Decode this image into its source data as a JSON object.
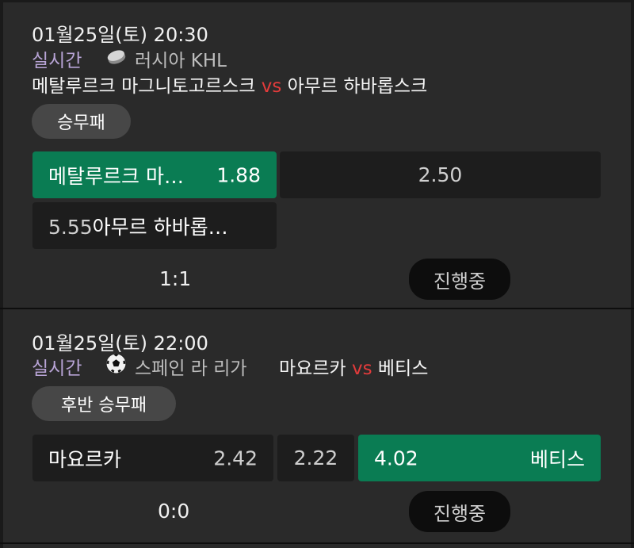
{
  "matches": [
    {
      "datetime": "01월25일(토) 20:30",
      "live_label": "실시간",
      "sport_icon": "hockey-puck-icon",
      "league": "러시아 KHL",
      "home": "메탈루르크 마그니토고르스크",
      "vs": "vs",
      "away": "아무르 하바롭스크",
      "market": "승무패",
      "odds": [
        {
          "name": "메탈루르크 마…",
          "value": "1.88",
          "selected": true
        },
        {
          "name": "",
          "value": "2.50",
          "selected": false
        },
        {
          "name": "아무르 하바롭…",
          "value": "5.55",
          "selected": false
        }
      ],
      "score": "1:1",
      "status": "진행중"
    },
    {
      "datetime": "01월25일(토) 22:00",
      "live_label": "실시간",
      "sport_icon": "soccer-ball-icon",
      "league": "스페인 라 리가",
      "home": "마요르카",
      "vs": "vs",
      "away": "베티스",
      "market": "후반 승무패",
      "odds": [
        {
          "name": "마요르카",
          "value": "2.42",
          "selected": false
        },
        {
          "name": "",
          "value": "2.22",
          "selected": false
        },
        {
          "name": "베티스",
          "value": "4.02",
          "selected": true
        }
      ],
      "score": "0:0",
      "status": "진행중"
    }
  ]
}
